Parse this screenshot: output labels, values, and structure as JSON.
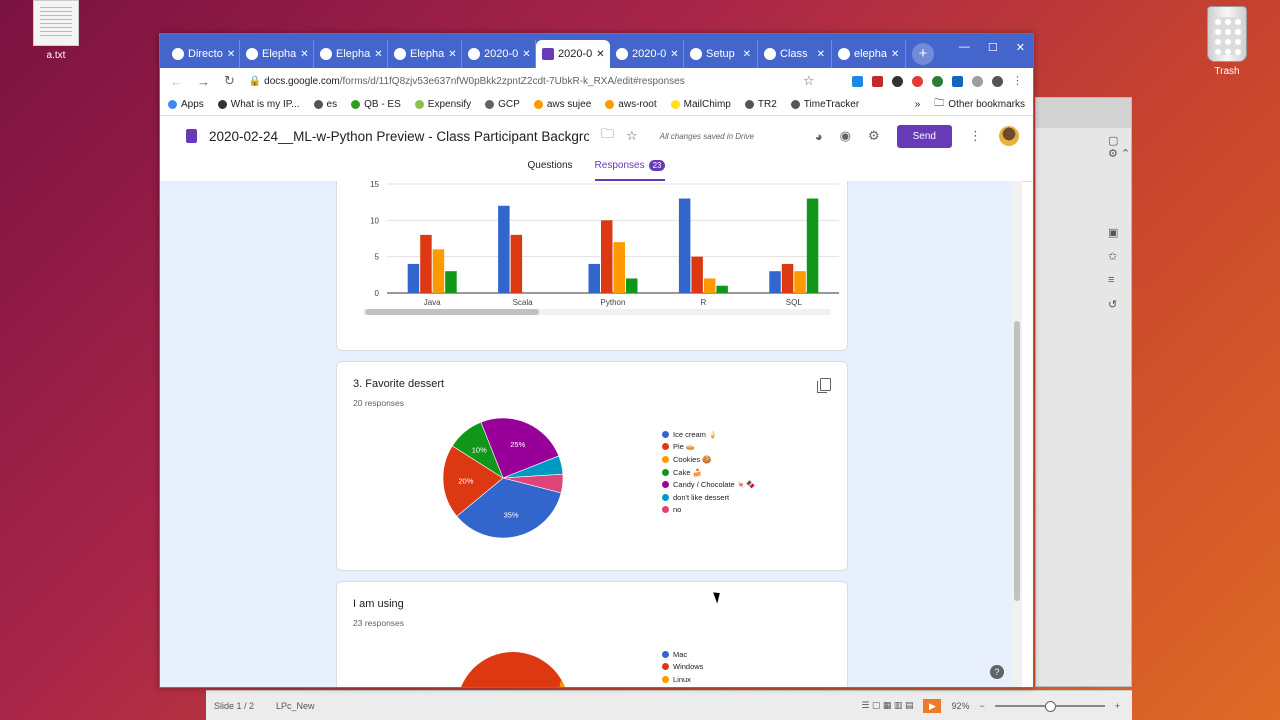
{
  "desktop": {
    "file_label": "a.txt",
    "trash_label": "Trash"
  },
  "browser": {
    "tabs": [
      {
        "label": "Directo",
        "icon": "elephant-icon"
      },
      {
        "label": "Elepha",
        "icon": "elephant-icon"
      },
      {
        "label": "Elepha",
        "icon": "elephant-icon"
      },
      {
        "label": "Elepha",
        "icon": "elephant-icon"
      },
      {
        "label": "2020-0",
        "icon": "drive-icon"
      },
      {
        "label": "2020-0",
        "icon": "forms-icon",
        "active": true
      },
      {
        "label": "2020-0",
        "icon": "docs-icon"
      },
      {
        "label": "Setup",
        "icon": "docs-icon"
      },
      {
        "label": "Class",
        "icon": "link-icon"
      },
      {
        "label": "elepha",
        "icon": "elephant-icon"
      }
    ],
    "url_host": "docs.google.com",
    "url_path": "/forms/d/11fQ8zjv53e637nfW0pBkk2zpntZ2cdt-7UbkR-k_RXA/edit#responses",
    "bookmarks": [
      {
        "label": "Apps",
        "color": "#4285f4"
      },
      {
        "label": "What is my IP...",
        "color": "#333333"
      },
      {
        "label": "es",
        "color": "#555555"
      },
      {
        "label": "QB - ES",
        "color": "#2ca01c"
      },
      {
        "label": "Expensify",
        "color": "#8bc34a"
      },
      {
        "label": "GCP",
        "color": "#5f6368"
      },
      {
        "label": "aws sujee",
        "color": "#ff9900"
      },
      {
        "label": "aws-root",
        "color": "#ff9900"
      },
      {
        "label": "MailChimp",
        "color": "#ffe01b"
      },
      {
        "label": "TR2",
        "color": "#555555"
      },
      {
        "label": "TimeTracker",
        "color": "#555555"
      }
    ],
    "bookmarks_more": "»",
    "other_bookmarks": "Other bookmarks"
  },
  "form": {
    "title": "2020-02-24__ML-w-Python Preview - Class Participant Background",
    "saved_status": "All changes saved in Drive",
    "send_label": "Send",
    "tab_questions": "Questions",
    "tab_responses": "Responses",
    "responses_count": "23"
  },
  "chart_data": [
    {
      "type": "bar",
      "title": "",
      "categories": [
        "Java",
        "Scala",
        "Python",
        "R",
        "SQL"
      ],
      "series": [
        {
          "color": "#3366cc",
          "values": [
            4,
            12,
            4,
            13,
            3
          ]
        },
        {
          "color": "#dc3912",
          "values": [
            8,
            8,
            10,
            5,
            4
          ]
        },
        {
          "color": "#ff9900",
          "values": [
            6,
            0,
            7,
            2,
            3
          ]
        },
        {
          "color": "#109618",
          "values": [
            3,
            0,
            2,
            1,
            13
          ]
        }
      ],
      "yticks": [
        "0",
        "5",
        "10",
        "15"
      ],
      "ylim": [
        0,
        15
      ],
      "grid": true
    },
    {
      "type": "pie",
      "title": "3. Favorite dessert",
      "responses": "20 responses",
      "slices": [
        {
          "label": "Ice cream 🍦",
          "value": 35,
          "color": "#3366cc",
          "pct": "35%"
        },
        {
          "label": "Pie 🥧",
          "value": 20,
          "color": "#dc3912",
          "pct": "20%"
        },
        {
          "label": "Cookies 🍪",
          "value": 0,
          "color": "#ff9900",
          "pct": ""
        },
        {
          "label": "Cake 🍰",
          "value": 10,
          "color": "#109618",
          "pct": "10%"
        },
        {
          "label": "Candy / Chocolate 🍬🍫",
          "value": 25,
          "color": "#990099",
          "pct": "25%"
        },
        {
          "label": "don't like dessert",
          "value": 5,
          "color": "#0099c6",
          "pct": ""
        },
        {
          "label": "no",
          "value": 5,
          "color": "#dd4477",
          "pct": ""
        }
      ]
    },
    {
      "type": "pie",
      "title": "I am using",
      "responses": "23 responses",
      "slices": [
        {
          "label": "Mac",
          "color": "#3366cc"
        },
        {
          "label": "Windows",
          "color": "#dc3912"
        },
        {
          "label": "Linux",
          "color": "#ff9900"
        }
      ]
    }
  ],
  "background_app": {
    "slide_indicator": "Slide 1 / 2",
    "layout_name": "LPc_New",
    "zoom": "92%"
  }
}
